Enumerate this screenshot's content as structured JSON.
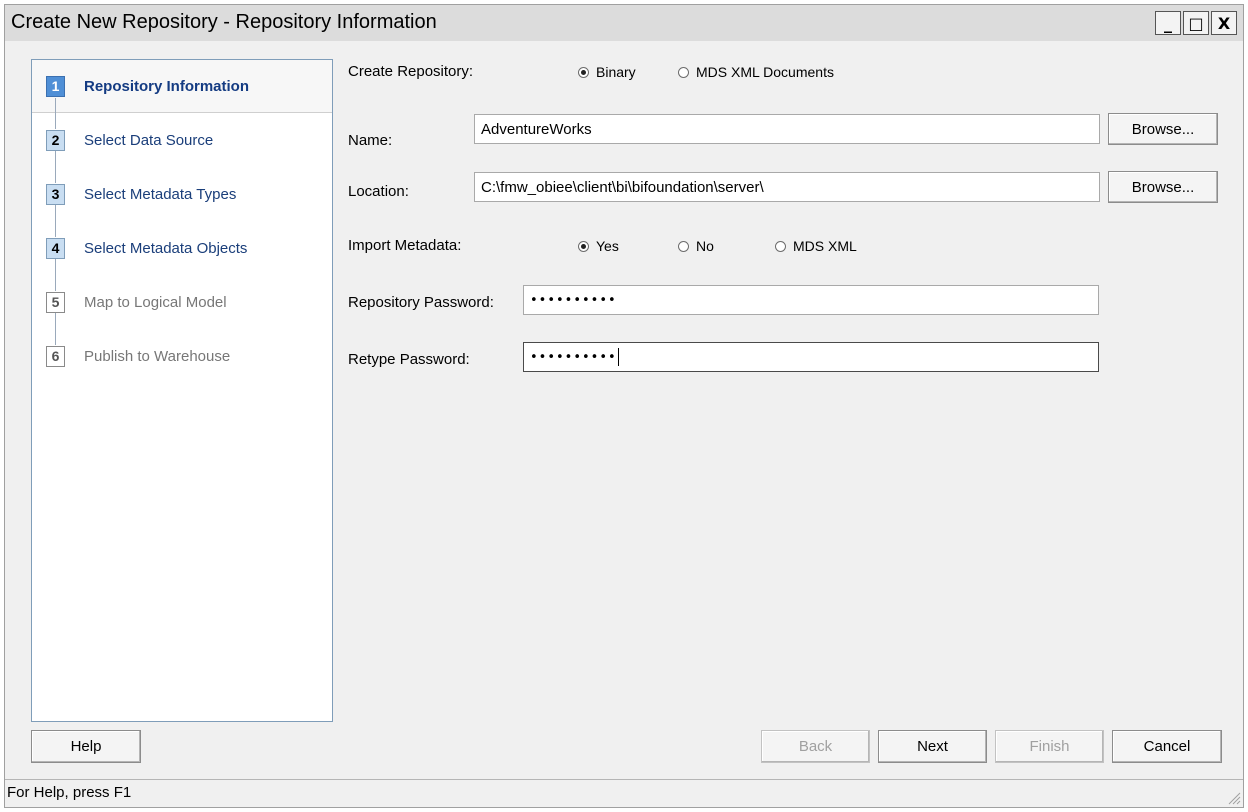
{
  "window": {
    "title": "Create New Repository - Repository Information",
    "minimize_glyph": "_",
    "maximize_glyph": "□",
    "close_glyph": "X"
  },
  "steps": [
    {
      "num": "1",
      "label": "Repository Information"
    },
    {
      "num": "2",
      "label": "Select Data Source"
    },
    {
      "num": "3",
      "label": "Select Metadata Types"
    },
    {
      "num": "4",
      "label": "Select Metadata Objects"
    },
    {
      "num": "5",
      "label": "Map to Logical Model"
    },
    {
      "num": "6",
      "label": "Publish to Warehouse"
    }
  ],
  "form": {
    "create_repository_label": "Create Repository:",
    "create_options": [
      {
        "label": "Binary",
        "checked": true
      },
      {
        "label": "MDS XML Documents",
        "checked": false
      }
    ],
    "name_label": "Name:",
    "name_value": "AdventureWorks",
    "location_label": "Location:",
    "location_value": "C:\\fmw_obiee\\client\\bi\\bifoundation\\server\\",
    "browse_label": "Browse...",
    "import_metadata_label": "Import Metadata:",
    "import_options": [
      {
        "label": "Yes",
        "checked": true
      },
      {
        "label": "No",
        "checked": false
      },
      {
        "label": "MDS XML",
        "checked": false
      }
    ],
    "repo_password_label": "Repository Password:",
    "repo_password_value": "••••••••••",
    "retype_password_label": "Retype Password:",
    "retype_password_value": "••••••••••"
  },
  "buttons": {
    "help": "Help",
    "back": "Back",
    "next": "Next",
    "finish": "Finish",
    "cancel": "Cancel"
  },
  "status": {
    "text": "For Help, press F1"
  }
}
